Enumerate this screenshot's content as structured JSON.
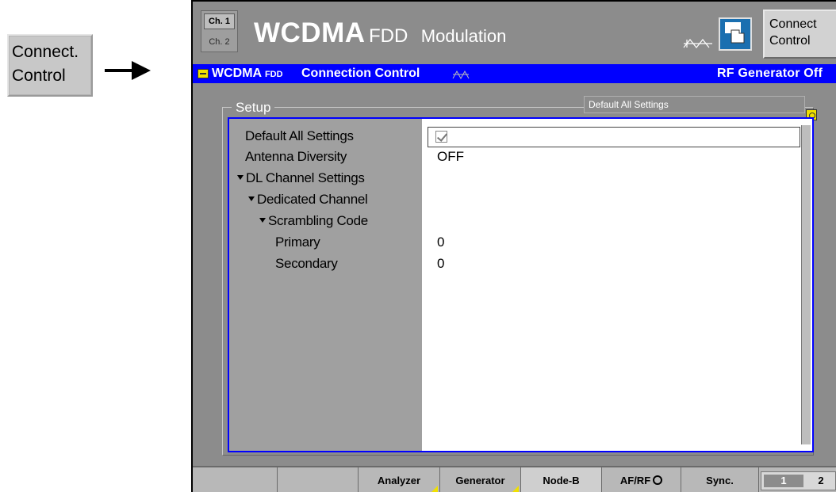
{
  "left_key": {
    "line1": "Connect.",
    "line2": "Control"
  },
  "header": {
    "ch1": "Ch. 1",
    "ch2": "Ch. 2",
    "title_main": "WCDMA",
    "title_fdd": "FDD",
    "title_mode": "Modulation",
    "connect_key_line1": "Connect",
    "connect_key_line2": "Control"
  },
  "bluebar": {
    "wcdma": "WCDMA",
    "fdd": "FDD",
    "title": "Connection Control",
    "status": "RF Generator Off"
  },
  "setup": {
    "group_label": "Setup",
    "default_tag": "Default All Settings",
    "rows": [
      {
        "label": "Default All Settings",
        "value": "",
        "checked": true
      },
      {
        "label": "Antenna Diversity",
        "value": "OFF"
      },
      {
        "label": "DL Channel Settings",
        "value": ""
      },
      {
        "label": "Dedicated Channel",
        "value": ""
      },
      {
        "label": "Scrambling Code",
        "value": ""
      },
      {
        "label": "Primary",
        "value": "0"
      },
      {
        "label": "Secondary",
        "value": "0"
      }
    ]
  },
  "softkeys": {
    "analyzer": "Analyzer",
    "generator": "Generator",
    "nodeb": "Node-B",
    "afrf": "AF/RF",
    "sync": "Sync.",
    "page1": "1",
    "page2": "2"
  },
  "colors": {
    "bar_blue": "#0000ff",
    "screen_gray": "#8c8c8c",
    "badge_yellow": "#f0e000"
  }
}
